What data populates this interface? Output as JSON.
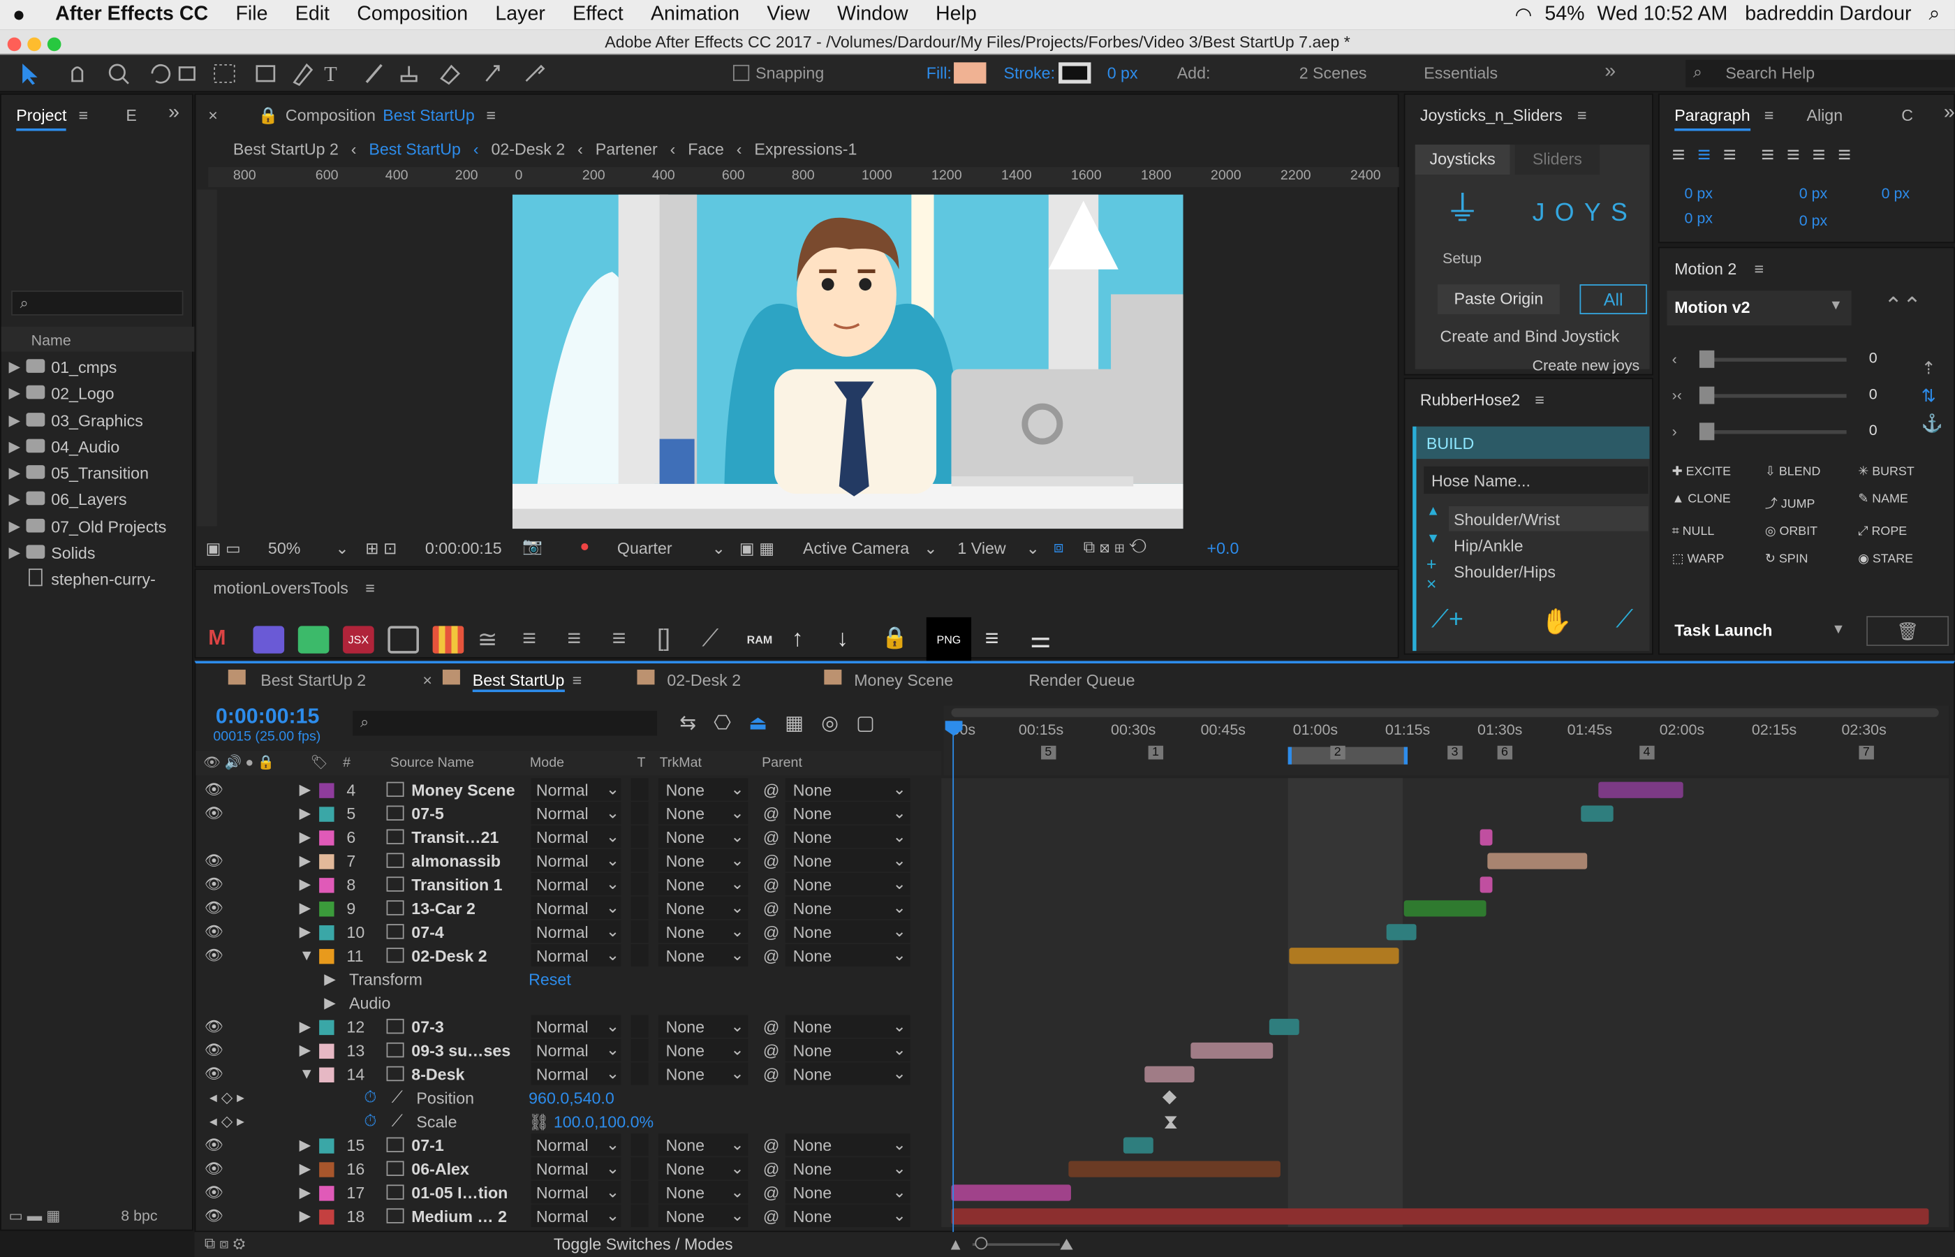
{
  "menubar": {
    "app": "After Effects CC",
    "items": [
      "File",
      "Edit",
      "Composition",
      "Layer",
      "Effect",
      "Animation",
      "View",
      "Window",
      "Help"
    ],
    "battery": "54%",
    "datetime": "Wed 10:52 AM",
    "user": "badreddin Dardour"
  },
  "title": "Adobe After Effects CC 2017 - /Volumes/Dardour/My Files/Projects/Forbes/Video 3/Best StartUp 7.aep *",
  "toolbar": {
    "snapping": "Snapping",
    "fill": "Fill:",
    "stroke": "Stroke:",
    "stroke_px": "0 px",
    "add": "Add:",
    "scenes": "2 Scenes",
    "workspace": "Essentials",
    "search": "Search Help"
  },
  "project": {
    "tab": "Project",
    "tab2": "E",
    "col_name": "Name",
    "items": [
      "01_cmps",
      "02_Logo",
      "03_Graphics",
      "04_Audio",
      "05_Transition",
      "06_Layers",
      "07_Old Projects",
      "Solids",
      "stephen-curry-"
    ],
    "bpc": "8 bpc"
  },
  "composition": {
    "tab_prefix": "Composition",
    "tab_name": "Best StartUp",
    "breadcrumbs": [
      "Best StartUp 2",
      "Best StartUp",
      "02-Desk 2",
      "Partener",
      "Face",
      "Expressions-1"
    ],
    "ruler": [
      "800",
      "600",
      "400",
      "200",
      "0",
      "200",
      "400",
      "600",
      "800",
      "1000",
      "1200",
      "1400",
      "1600",
      "1800",
      "2000",
      "2200",
      "2400"
    ],
    "zoom": "50%",
    "time": "0:00:00:15",
    "resolution": "Quarter",
    "camera": "Active Camera",
    "view": "1 View",
    "exposure": "+0.0"
  },
  "motionlovers": {
    "title": "motionLoversTools",
    "png": "PNG",
    "ram": "RAM",
    "jsx": "JSX"
  },
  "joysticks": {
    "title": "Joysticks_n_Sliders",
    "tabs": [
      "Joysticks",
      "Sliders"
    ],
    "logo": "JOYS",
    "setup": "Setup",
    "paste": "Paste Origin",
    "all": "All",
    "create": "Create and Bind Joystick",
    "create_new": "Create new joys"
  },
  "rubberhose": {
    "title": "RubberHose2",
    "build": "BUILD",
    "hose_name": "Hose Name...",
    "items": [
      "Shoulder/Wrist",
      "Hip/Ankle",
      "Shoulder/Hips"
    ]
  },
  "paragraph": {
    "tabs": [
      "Paragraph",
      "Align",
      "C"
    ],
    "vals": [
      "0 px",
      "0 px",
      "0 px",
      "0 px",
      "0 px"
    ]
  },
  "motion": {
    "title": "Motion 2",
    "version": "Motion v2",
    "sliders": [
      "0",
      "0",
      "0"
    ],
    "buttons": [
      "EXCITE",
      "BLEND",
      "BURST",
      "CLONE",
      "JUMP",
      "NAME",
      "NULL",
      "ORBIT",
      "ROPE",
      "WARP",
      "SPIN",
      "STARE"
    ],
    "task": "Task Launch"
  },
  "timeline": {
    "tabs": [
      "Best StartUp 2",
      "Best StartUp",
      "02-Desk 2",
      "Money Scene",
      "Render Queue"
    ],
    "timecode": "0:00:00:15",
    "fps": "00015 (25.00 fps)",
    "cols": [
      "#",
      "Source Name",
      "Mode",
      "T",
      "TrkMat",
      "Parent"
    ],
    "ticks": [
      "00s",
      "00:15s",
      "00:30s",
      "00:45s",
      "01:00s",
      "01:15s",
      "01:30s",
      "01:45s",
      "02:00s",
      "02:15s",
      "02:30s"
    ],
    "markers": [
      "5",
      "1",
      "2",
      "3",
      "6",
      "4",
      "7"
    ],
    "toggle": "Toggle Switches / Modes",
    "layers": [
      {
        "n": "4",
        "name": "Money Scene",
        "mode": "Normal",
        "trk": "None",
        "parent": "None",
        "color": "#8e3c9c"
      },
      {
        "n": "5",
        "name": "07-5",
        "mode": "Normal",
        "trk": "None",
        "parent": "None",
        "color": "#3aa7a7"
      },
      {
        "n": "6",
        "name": "Transit…21",
        "mode": "Normal",
        "trk": "None",
        "parent": "None",
        "color": "#e05ab8"
      },
      {
        "n": "7",
        "name": "almonassib",
        "mode": "Normal",
        "trk": "None",
        "parent": "None",
        "color": "#e2b99a"
      },
      {
        "n": "8",
        "name": "Transition 1",
        "mode": "Normal",
        "trk": "None",
        "parent": "None",
        "color": "#e05ab8"
      },
      {
        "n": "9",
        "name": "13-Car 2",
        "mode": "Normal",
        "trk": "None",
        "parent": "None",
        "color": "#3b9b3b"
      },
      {
        "n": "10",
        "name": "07-4",
        "mode": "Normal",
        "trk": "None",
        "parent": "None",
        "color": "#3aa7a7"
      },
      {
        "n": "11",
        "name": "02-Desk 2",
        "mode": "Normal",
        "trk": "None",
        "parent": "None",
        "color": "#e89a1c"
      },
      {
        "n": "12",
        "name": "07-3",
        "mode": "Normal",
        "trk": "None",
        "parent": "None",
        "color": "#3aa7a7"
      },
      {
        "n": "13",
        "name": "09-3 su…ses",
        "mode": "Normal",
        "trk": "None",
        "parent": "None",
        "color": "#e6b8c4"
      },
      {
        "n": "14",
        "name": "8-Desk",
        "mode": "Normal",
        "trk": "None",
        "parent": "None",
        "color": "#e6b8c4"
      },
      {
        "n": "15",
        "name": "07-1",
        "mode": "Normal",
        "trk": "None",
        "parent": "None",
        "color": "#3aa7a7"
      },
      {
        "n": "16",
        "name": "06-Alex",
        "mode": "Normal",
        "trk": "None",
        "parent": "None",
        "color": "#a8562c"
      },
      {
        "n": "17",
        "name": "01-05 I…tion",
        "mode": "Normal",
        "trk": "None",
        "parent": "None",
        "color": "#e05ab8"
      },
      {
        "n": "18",
        "name": "Medium … 2",
        "mode": "Normal",
        "trk": "None",
        "parent": "None",
        "color": "#c44040"
      }
    ],
    "transform": "Transform",
    "audio": "Audio",
    "reset": "Reset",
    "position_label": "Position",
    "position_val": "960.0,540.0",
    "scale_label": "Scale",
    "scale_val": "100.0,100.0%"
  }
}
